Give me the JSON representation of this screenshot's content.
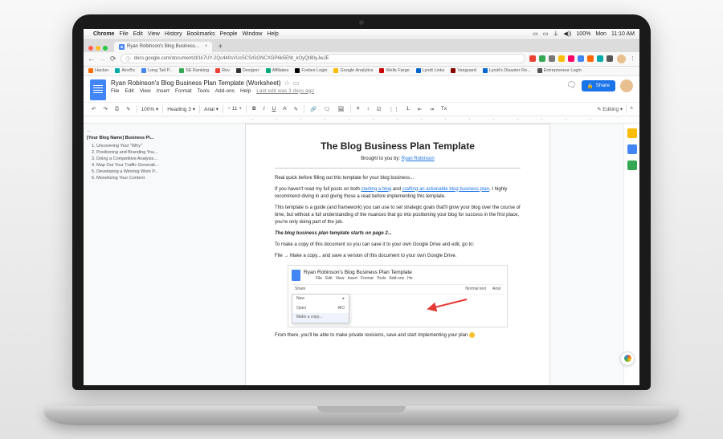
{
  "mac_menu": {
    "apple": "",
    "app": "Chrome",
    "items": [
      "File",
      "Edit",
      "View",
      "History",
      "Bookmarks",
      "People",
      "Window",
      "Help"
    ],
    "status": {
      "volume": "100%",
      "day": "Mon",
      "time": "11:10 AM"
    }
  },
  "chrome": {
    "tab_title": "Ryan Robinson's Blog Business...",
    "url": "docs.google.com/document/d/1k7UY-2Qc440sVUc5CS/GGNCXGP6k5ENt_kOyQI80yJwJE",
    "ext_colors": [
      "#e94335",
      "#34a853",
      "#777",
      "#fbbc05",
      "#f06",
      "#4285f4",
      "#f60",
      "#0aa",
      "#555"
    ]
  },
  "bookmarks": [
    {
      "c": "#ff6d00",
      "t": "Hacker"
    },
    {
      "c": "#0aa",
      "t": "Airoft's"
    },
    {
      "c": "#4285f4",
      "t": "Long Tail P..."
    },
    {
      "c": "#34a853",
      "t": "SE Ranking"
    },
    {
      "c": "#ea4335",
      "t": "Rev"
    },
    {
      "c": "#333",
      "t": "Designrr"
    },
    {
      "c": "#0a7",
      "t": "Affiliates"
    },
    {
      "c": "#000",
      "t": "Forbes Login"
    },
    {
      "c": "#fbbc05",
      "t": "Google Analytics"
    },
    {
      "c": "#c00",
      "t": "Wells Fargo"
    },
    {
      "c": "#06c",
      "t": "Lyndt Links"
    },
    {
      "c": "#800",
      "t": "Vanguard"
    },
    {
      "c": "#06c",
      "t": "Lyndt's Disaster Re..."
    },
    {
      "c": "#555",
      "t": "Entrepreneur Login"
    }
  ],
  "docs": {
    "title": "Ryan Robinson's Blog Business Plan Template (Worksheet)",
    "menus": [
      "File",
      "Edit",
      "View",
      "Insert",
      "Format",
      "Tools",
      "Add-ons",
      "Help"
    ],
    "last_edit": "Last edit was 3 days ago",
    "share": "Share",
    "editing": "Editing",
    "toolbar": {
      "zoom": "100%",
      "style": "Heading 3",
      "font": "Arial",
      "size": "11"
    }
  },
  "outline": {
    "title": "[Your Blog Name] Business Pl...",
    "items": [
      "1. Uncovering Your \"Why\"",
      "2. Positioning and Branding You...",
      "3. Doing a Competitive Analysis...",
      "4. Map Out Your Traffic Generati...",
      "5. Developing a Winning Work P...",
      "6. Monetizing Your Content"
    ]
  },
  "document": {
    "h1": "The Blog Business Plan Template",
    "byline_pre": "Brought to you by: ",
    "byline_link": "Ryan Robinson",
    "p1": "Real quick before filling out this template for your blog business...",
    "p2a": "If you haven't read my full posts on both ",
    "p2_link1": "starting a blog",
    "p2b": " and ",
    "p2_link2": "crafting an actionable blog business plan",
    "p2c": ", I highly recommend diving in and giving those a read before implementing this template.",
    "p3": "This template is a guide (and framework) you can use to set strategic goals that'll grow your blog over the course of time, but without a full understanding of the nuances that go into positioning your blog for success in the first place, you're only doing part of the job.",
    "p4": "The blog business plan template starts on page 2...",
    "p5": "To make a copy of this document so you can save it to your own Google Drive and edit, go to:",
    "p6": "File → Make a copy... and save a version of this document to your own Google Drive.",
    "nested": {
      "title": "Ryan Robinson's Blog Business Plan Template",
      "menu": [
        "File",
        "Edit",
        "View",
        "Insert",
        "Format",
        "Tools",
        "Add-ons",
        "He"
      ],
      "tb_share": "Share",
      "tb_style": "Normal text",
      "tb_font": "Arial",
      "dd": [
        {
          "l": "New",
          "r": "▸"
        },
        {
          "l": "Open",
          "r": "⌘O"
        },
        {
          "l": "Make a copy...",
          "r": ""
        }
      ]
    },
    "p7": "From there, you'll be able to make private revisions, save and start implementing your plan "
  },
  "rail_colors": [
    "#fbbc05",
    "#4285f4",
    "#34a853"
  ]
}
